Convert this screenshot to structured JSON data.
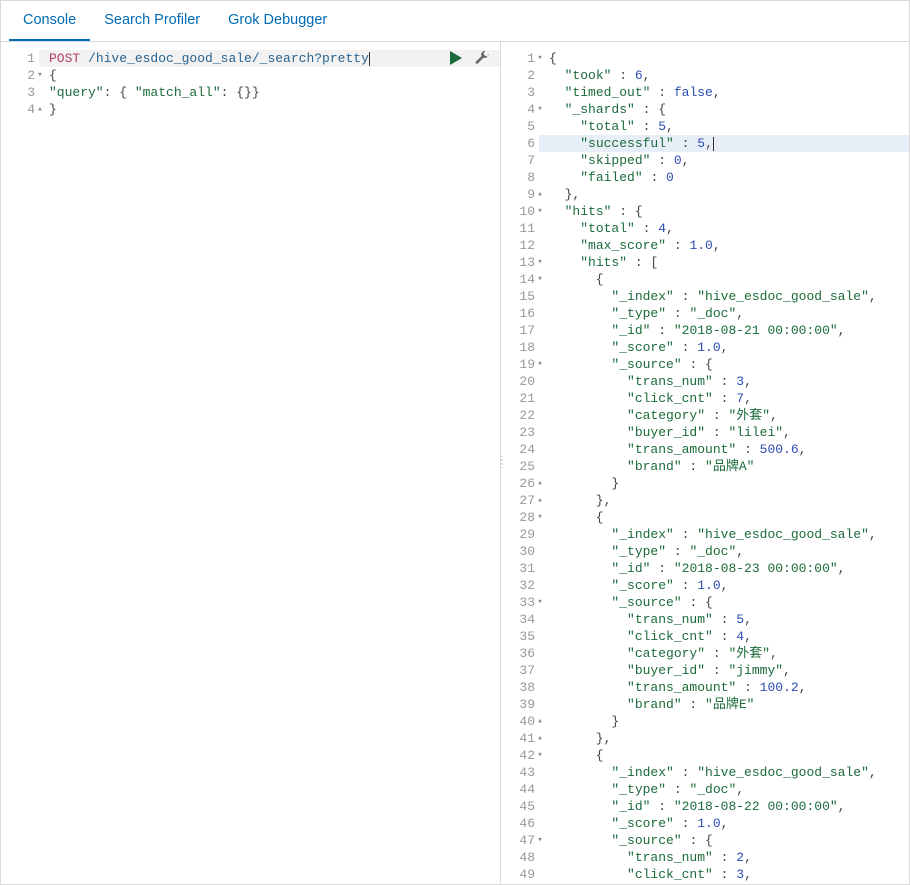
{
  "tabs": [
    {
      "label": "Console",
      "active": true
    },
    {
      "label": "Search Profiler",
      "active": false
    },
    {
      "label": "Grok Debugger",
      "active": false
    }
  ],
  "request": {
    "method": "POST",
    "path": "/hive_esdoc_good_sale/_search?pretty",
    "lines": [
      {
        "n": 1,
        "fold": "",
        "method": "POST",
        "url": " /hive_esdoc_good_sale/_search?pretty"
      },
      {
        "n": 2,
        "fold": "▾",
        "raw": "{"
      },
      {
        "n": 3,
        "fold": "",
        "tokens": [
          [
            "str",
            "\"query\""
          ],
          [
            "pun",
            ": { "
          ],
          [
            "str",
            "\"match_all\""
          ],
          [
            "pun",
            ": {}}"
          ]
        ]
      },
      {
        "n": 4,
        "fold": "▴",
        "raw": "}"
      }
    ]
  },
  "response": {
    "highlighted_line": 6,
    "lines": [
      {
        "n": 1,
        "fold": "▾",
        "tokens": [
          [
            "pun",
            "{"
          ]
        ]
      },
      {
        "n": 2,
        "fold": "",
        "tokens": [
          [
            "pun",
            "  "
          ],
          [
            "str",
            "\"took\""
          ],
          [
            "pun",
            " : "
          ],
          [
            "num",
            "6"
          ],
          [
            "pun",
            ","
          ]
        ]
      },
      {
        "n": 3,
        "fold": "",
        "tokens": [
          [
            "pun",
            "  "
          ],
          [
            "str",
            "\"timed_out\""
          ],
          [
            "pun",
            " : "
          ],
          [
            "bool",
            "false"
          ],
          [
            "pun",
            ","
          ]
        ]
      },
      {
        "n": 4,
        "fold": "▾",
        "tokens": [
          [
            "pun",
            "  "
          ],
          [
            "str",
            "\"_shards\""
          ],
          [
            "pun",
            " : {"
          ]
        ]
      },
      {
        "n": 5,
        "fold": "",
        "tokens": [
          [
            "pun",
            "    "
          ],
          [
            "str",
            "\"total\""
          ],
          [
            "pun",
            " : "
          ],
          [
            "num",
            "5"
          ],
          [
            "pun",
            ","
          ]
        ]
      },
      {
        "n": 6,
        "fold": "",
        "hl": true,
        "tokens": [
          [
            "pun",
            "    "
          ],
          [
            "str",
            "\"successful\""
          ],
          [
            "pun",
            " : "
          ],
          [
            "num",
            "5"
          ],
          [
            "pun",
            ","
          ]
        ]
      },
      {
        "n": 7,
        "fold": "",
        "tokens": [
          [
            "pun",
            "    "
          ],
          [
            "str",
            "\"skipped\""
          ],
          [
            "pun",
            " : "
          ],
          [
            "num",
            "0"
          ],
          [
            "pun",
            ","
          ]
        ]
      },
      {
        "n": 8,
        "fold": "",
        "tokens": [
          [
            "pun",
            "    "
          ],
          [
            "str",
            "\"failed\""
          ],
          [
            "pun",
            " : "
          ],
          [
            "num",
            "0"
          ]
        ]
      },
      {
        "n": 9,
        "fold": "▴",
        "tokens": [
          [
            "pun",
            "  },"
          ]
        ]
      },
      {
        "n": 10,
        "fold": "▾",
        "tokens": [
          [
            "pun",
            "  "
          ],
          [
            "str",
            "\"hits\""
          ],
          [
            "pun",
            " : {"
          ]
        ]
      },
      {
        "n": 11,
        "fold": "",
        "tokens": [
          [
            "pun",
            "    "
          ],
          [
            "str",
            "\"total\""
          ],
          [
            "pun",
            " : "
          ],
          [
            "num",
            "4"
          ],
          [
            "pun",
            ","
          ]
        ]
      },
      {
        "n": 12,
        "fold": "",
        "tokens": [
          [
            "pun",
            "    "
          ],
          [
            "str",
            "\"max_score\""
          ],
          [
            "pun",
            " : "
          ],
          [
            "num",
            "1.0"
          ],
          [
            "pun",
            ","
          ]
        ]
      },
      {
        "n": 13,
        "fold": "▾",
        "tokens": [
          [
            "pun",
            "    "
          ],
          [
            "str",
            "\"hits\""
          ],
          [
            "pun",
            " : ["
          ]
        ]
      },
      {
        "n": 14,
        "fold": "▾",
        "tokens": [
          [
            "pun",
            "      {"
          ]
        ]
      },
      {
        "n": 15,
        "fold": "",
        "tokens": [
          [
            "pun",
            "        "
          ],
          [
            "str",
            "\"_index\""
          ],
          [
            "pun",
            " : "
          ],
          [
            "str",
            "\"hive_esdoc_good_sale\""
          ],
          [
            "pun",
            ","
          ]
        ]
      },
      {
        "n": 16,
        "fold": "",
        "tokens": [
          [
            "pun",
            "        "
          ],
          [
            "str",
            "\"_type\""
          ],
          [
            "pun",
            " : "
          ],
          [
            "str",
            "\"_doc\""
          ],
          [
            "pun",
            ","
          ]
        ]
      },
      {
        "n": 17,
        "fold": "",
        "tokens": [
          [
            "pun",
            "        "
          ],
          [
            "str",
            "\"_id\""
          ],
          [
            "pun",
            " : "
          ],
          [
            "str",
            "\"2018-08-21 00:00:00\""
          ],
          [
            "pun",
            ","
          ]
        ]
      },
      {
        "n": 18,
        "fold": "",
        "tokens": [
          [
            "pun",
            "        "
          ],
          [
            "str",
            "\"_score\""
          ],
          [
            "pun",
            " : "
          ],
          [
            "num",
            "1.0"
          ],
          [
            "pun",
            ","
          ]
        ]
      },
      {
        "n": 19,
        "fold": "▾",
        "tokens": [
          [
            "pun",
            "        "
          ],
          [
            "str",
            "\"_source\""
          ],
          [
            "pun",
            " : {"
          ]
        ]
      },
      {
        "n": 20,
        "fold": "",
        "tokens": [
          [
            "pun",
            "          "
          ],
          [
            "str",
            "\"trans_num\""
          ],
          [
            "pun",
            " : "
          ],
          [
            "num",
            "3"
          ],
          [
            "pun",
            ","
          ]
        ]
      },
      {
        "n": 21,
        "fold": "",
        "tokens": [
          [
            "pun",
            "          "
          ],
          [
            "str",
            "\"click_cnt\""
          ],
          [
            "pun",
            " : "
          ],
          [
            "num",
            "7"
          ],
          [
            "pun",
            ","
          ]
        ]
      },
      {
        "n": 22,
        "fold": "",
        "tokens": [
          [
            "pun",
            "          "
          ],
          [
            "str",
            "\"category\""
          ],
          [
            "pun",
            " : "
          ],
          [
            "str",
            "\"外套\""
          ],
          [
            "pun",
            ","
          ]
        ]
      },
      {
        "n": 23,
        "fold": "",
        "tokens": [
          [
            "pun",
            "          "
          ],
          [
            "str",
            "\"buyer_id\""
          ],
          [
            "pun",
            " : "
          ],
          [
            "str",
            "\"lilei\""
          ],
          [
            "pun",
            ","
          ]
        ]
      },
      {
        "n": 24,
        "fold": "",
        "tokens": [
          [
            "pun",
            "          "
          ],
          [
            "str",
            "\"trans_amount\""
          ],
          [
            "pun",
            " : "
          ],
          [
            "num",
            "500.6"
          ],
          [
            "pun",
            ","
          ]
        ]
      },
      {
        "n": 25,
        "fold": "",
        "tokens": [
          [
            "pun",
            "          "
          ],
          [
            "str",
            "\"brand\""
          ],
          [
            "pun",
            " : "
          ],
          [
            "str",
            "\"品牌A\""
          ]
        ]
      },
      {
        "n": 26,
        "fold": "▴",
        "tokens": [
          [
            "pun",
            "        }"
          ]
        ]
      },
      {
        "n": 27,
        "fold": "▴",
        "tokens": [
          [
            "pun",
            "      },"
          ]
        ]
      },
      {
        "n": 28,
        "fold": "▾",
        "tokens": [
          [
            "pun",
            "      {"
          ]
        ]
      },
      {
        "n": 29,
        "fold": "",
        "tokens": [
          [
            "pun",
            "        "
          ],
          [
            "str",
            "\"_index\""
          ],
          [
            "pun",
            " : "
          ],
          [
            "str",
            "\"hive_esdoc_good_sale\""
          ],
          [
            "pun",
            ","
          ]
        ]
      },
      {
        "n": 30,
        "fold": "",
        "tokens": [
          [
            "pun",
            "        "
          ],
          [
            "str",
            "\"_type\""
          ],
          [
            "pun",
            " : "
          ],
          [
            "str",
            "\"_doc\""
          ],
          [
            "pun",
            ","
          ]
        ]
      },
      {
        "n": 31,
        "fold": "",
        "tokens": [
          [
            "pun",
            "        "
          ],
          [
            "str",
            "\"_id\""
          ],
          [
            "pun",
            " : "
          ],
          [
            "str",
            "\"2018-08-23 00:00:00\""
          ],
          [
            "pun",
            ","
          ]
        ]
      },
      {
        "n": 32,
        "fold": "",
        "tokens": [
          [
            "pun",
            "        "
          ],
          [
            "str",
            "\"_score\""
          ],
          [
            "pun",
            " : "
          ],
          [
            "num",
            "1.0"
          ],
          [
            "pun",
            ","
          ]
        ]
      },
      {
        "n": 33,
        "fold": "▾",
        "tokens": [
          [
            "pun",
            "        "
          ],
          [
            "str",
            "\"_source\""
          ],
          [
            "pun",
            " : {"
          ]
        ]
      },
      {
        "n": 34,
        "fold": "",
        "tokens": [
          [
            "pun",
            "          "
          ],
          [
            "str",
            "\"trans_num\""
          ],
          [
            "pun",
            " : "
          ],
          [
            "num",
            "5"
          ],
          [
            "pun",
            ","
          ]
        ]
      },
      {
        "n": 35,
        "fold": "",
        "tokens": [
          [
            "pun",
            "          "
          ],
          [
            "str",
            "\"click_cnt\""
          ],
          [
            "pun",
            " : "
          ],
          [
            "num",
            "4"
          ],
          [
            "pun",
            ","
          ]
        ]
      },
      {
        "n": 36,
        "fold": "",
        "tokens": [
          [
            "pun",
            "          "
          ],
          [
            "str",
            "\"category\""
          ],
          [
            "pun",
            " : "
          ],
          [
            "str",
            "\"外套\""
          ],
          [
            "pun",
            ","
          ]
        ]
      },
      {
        "n": 37,
        "fold": "",
        "tokens": [
          [
            "pun",
            "          "
          ],
          [
            "str",
            "\"buyer_id\""
          ],
          [
            "pun",
            " : "
          ],
          [
            "str",
            "\"jimmy\""
          ],
          [
            "pun",
            ","
          ]
        ]
      },
      {
        "n": 38,
        "fold": "",
        "tokens": [
          [
            "pun",
            "          "
          ],
          [
            "str",
            "\"trans_amount\""
          ],
          [
            "pun",
            " : "
          ],
          [
            "num",
            "100.2"
          ],
          [
            "pun",
            ","
          ]
        ]
      },
      {
        "n": 39,
        "fold": "",
        "tokens": [
          [
            "pun",
            "          "
          ],
          [
            "str",
            "\"brand\""
          ],
          [
            "pun",
            " : "
          ],
          [
            "str",
            "\"品牌E\""
          ]
        ]
      },
      {
        "n": 40,
        "fold": "▴",
        "tokens": [
          [
            "pun",
            "        }"
          ]
        ]
      },
      {
        "n": 41,
        "fold": "▴",
        "tokens": [
          [
            "pun",
            "      },"
          ]
        ]
      },
      {
        "n": 42,
        "fold": "▾",
        "tokens": [
          [
            "pun",
            "      {"
          ]
        ]
      },
      {
        "n": 43,
        "fold": "",
        "tokens": [
          [
            "pun",
            "        "
          ],
          [
            "str",
            "\"_index\""
          ],
          [
            "pun",
            " : "
          ],
          [
            "str",
            "\"hive_esdoc_good_sale\""
          ],
          [
            "pun",
            ","
          ]
        ]
      },
      {
        "n": 44,
        "fold": "",
        "tokens": [
          [
            "pun",
            "        "
          ],
          [
            "str",
            "\"_type\""
          ],
          [
            "pun",
            " : "
          ],
          [
            "str",
            "\"_doc\""
          ],
          [
            "pun",
            ","
          ]
        ]
      },
      {
        "n": 45,
        "fold": "",
        "tokens": [
          [
            "pun",
            "        "
          ],
          [
            "str",
            "\"_id\""
          ],
          [
            "pun",
            " : "
          ],
          [
            "str",
            "\"2018-08-22 00:00:00\""
          ],
          [
            "pun",
            ","
          ]
        ]
      },
      {
        "n": 46,
        "fold": "",
        "tokens": [
          [
            "pun",
            "        "
          ],
          [
            "str",
            "\"_score\""
          ],
          [
            "pun",
            " : "
          ],
          [
            "num",
            "1.0"
          ],
          [
            "pun",
            ","
          ]
        ]
      },
      {
        "n": 47,
        "fold": "▾",
        "tokens": [
          [
            "pun",
            "        "
          ],
          [
            "str",
            "\"_source\""
          ],
          [
            "pun",
            " : {"
          ]
        ]
      },
      {
        "n": 48,
        "fold": "",
        "tokens": [
          [
            "pun",
            "          "
          ],
          [
            "str",
            "\"trans_num\""
          ],
          [
            "pun",
            " : "
          ],
          [
            "num",
            "2"
          ],
          [
            "pun",
            ","
          ]
        ]
      },
      {
        "n": 49,
        "fold": "",
        "tokens": [
          [
            "pun",
            "          "
          ],
          [
            "str",
            "\"click_cnt\""
          ],
          [
            "pun",
            " : "
          ],
          [
            "num",
            "3"
          ],
          [
            "pun",
            ","
          ]
        ]
      }
    ]
  }
}
